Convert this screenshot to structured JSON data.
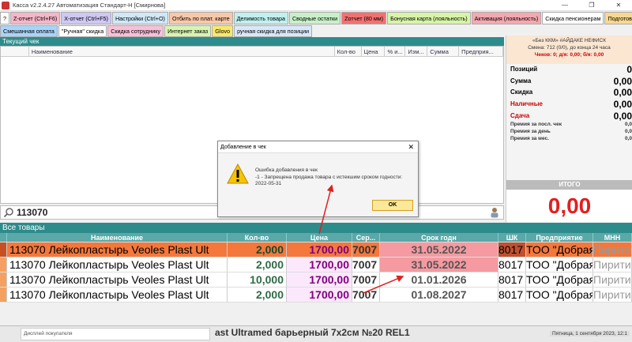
{
  "window": {
    "title": "Касса v2.2.4.27 Автоматизация Стандарт-Н [Смирнова]",
    "controls": [
      "—",
      "❐",
      "✕"
    ]
  },
  "toolbar_row1": [
    {
      "label": "?",
      "color": "#ffffff"
    },
    {
      "label": "Z-отчет (Ctrl+F6)",
      "color": "#f4b6c8"
    },
    {
      "label": "X-отчет (Ctrl+F5)",
      "color": "#cfc8f4"
    },
    {
      "label": "Настройки (Ctrl+O)",
      "color": "#d0e8f8"
    },
    {
      "label": "Отбить по плат. карте",
      "color": "#f8c8a8"
    },
    {
      "label": "Делимость товара",
      "color": "#c0f0f0"
    },
    {
      "label": "Сводные остатки",
      "color": "#c8f0c8"
    },
    {
      "label": "Zотчет (80 мм)",
      "color": "#f47070"
    },
    {
      "label": "Бонусная карта (лояльность)",
      "color": "#d8f4a8"
    },
    {
      "label": "Активация (лояльность)",
      "color": "#f4a8b0"
    },
    {
      "label": "Скидка пенсионерам",
      "color": "#ffffff"
    },
    {
      "label": "Подготовить чек по безна",
      "color": "#f8d890"
    }
  ],
  "toolbar_row2": [
    {
      "label": "Смешанная оплата",
      "color": "#a8d4f8"
    },
    {
      "label": "\"Ручная\" скидка",
      "color": "#ffffff"
    },
    {
      "label": "Скидка сотруднику",
      "color": "#f8c0d8"
    },
    {
      "label": "Интернет заказ",
      "color": "#d8f4b0"
    },
    {
      "label": "Glovo",
      "color": "#f8e868"
    },
    {
      "label": "ручная скидка для позиции",
      "color": "#d8e8f8"
    }
  ],
  "current_check": {
    "header": "Текущий чек",
    "columns": [
      "",
      "Наименование",
      "Кол-во",
      "Цена",
      "% и...",
      "Изм...",
      "Сумма",
      "Предприя..."
    ]
  },
  "info": {
    "line1": "«Без ККМ» #АЙДАКЕ НЕФИСК",
    "line2": "Смена: 712 (0/0), до конца 24 часа",
    "line3": "Чеков: 0; д/я: 0,00; б/я: 0,00"
  },
  "stats": {
    "positions_label": "Позиций",
    "positions_value": "0",
    "sum_label": "Сумма",
    "sum_value": "0,00",
    "discount_label": "Скидка",
    "discount_value": "0,00",
    "cash_label": "Наличные",
    "cash_value": "0,00",
    "change_label": "Сдача",
    "change_value": "0,00",
    "bonus_check_label": "Премия за посл. чек",
    "bonus_check_value": "0,0",
    "bonus_day_label": "Премия за день",
    "bonus_day_value": "0,0",
    "bonus_month_label": "Премия за мес.",
    "bonus_month_value": "0,0"
  },
  "total": {
    "label": "ИТОГО",
    "value": "0,00"
  },
  "search": {
    "value": "113070"
  },
  "goods": {
    "header": "Все товары",
    "columns": [
      "",
      "Наименование",
      "Кол-во",
      "Цена",
      "Сер...",
      "Срок годн",
      "ШК",
      "Предприятие",
      "МНН"
    ],
    "rows": [
      {
        "name": "113070 Лейкопластырь Veoles Plast Ult",
        "qty": "2,000",
        "price": "1700,00",
        "series": "7007",
        "expiry": "31.05.2022",
        "barcode": "8017",
        "company": "ТОО \"Добрая А",
        "inn": "Пирити",
        "selected": true,
        "expired": true
      },
      {
        "name": "113070 Лейкопластырь Veoles Plast Ult",
        "qty": "2,000",
        "price": "1700,00",
        "series": "7007",
        "expiry": "31.05.2022",
        "barcode": "8017",
        "company": "ТОО \"Добрая А",
        "inn": "Пирити",
        "selected": false,
        "expired": true
      },
      {
        "name": "113070 Лейкопластырь Veoles Plast Ult",
        "qty": "10,000",
        "price": "1700,00",
        "series": "7007",
        "expiry": "01.01.2026",
        "barcode": "8017",
        "company": "ТОО \"Добрая А",
        "inn": "Пирити",
        "selected": false,
        "expired": false
      },
      {
        "name": "113070 Лейкопластырь Veoles Plast Ult",
        "qty": "2,000",
        "price": "1700,00",
        "series": "7007",
        "expiry": "01.08.2027",
        "barcode": "8017",
        "company": "ТОО \"Добрая А",
        "inn": "Пирити",
        "selected": false,
        "expired": false
      }
    ]
  },
  "status": {
    "display_label": "Дисплей покупателя",
    "product_name": "ast Ultramed барьерный 7x2см №20 REL1",
    "date": "Пятница, 1 сентября 2023, 12:1"
  },
  "dialog": {
    "title": "Добавление в чек",
    "close": "✕",
    "line1": "Ошибка добавления в чек",
    "line2": "-1 - Запрещена продажа товара с истекшим сроком годности:",
    "line3": "2022-05-31",
    "ok_label": "OK"
  },
  "colors": {
    "teal": "#2e8b8b",
    "selected_row": "#f4783c",
    "expired_cell": "#f49aa0",
    "total_red": "#e02020",
    "arrow": "#e02020"
  }
}
